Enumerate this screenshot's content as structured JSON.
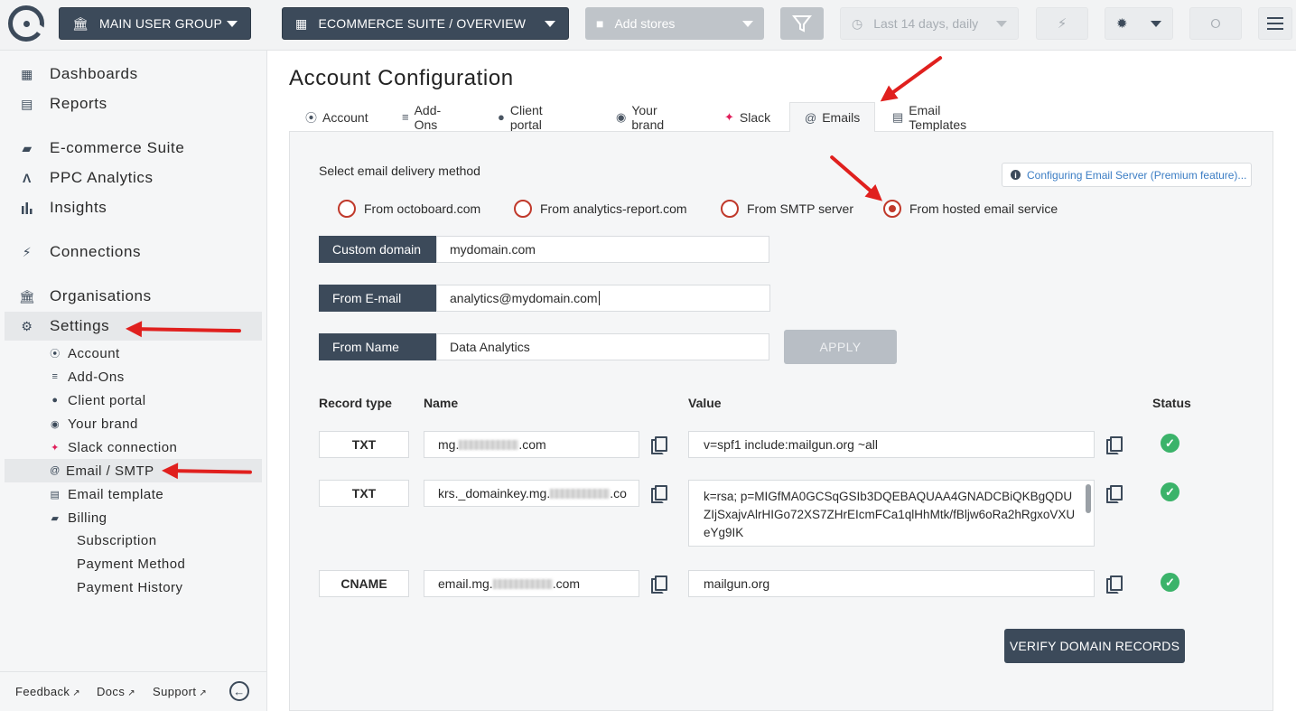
{
  "topbar": {
    "user_group": "MAIN USER GROUP",
    "dashboard": "ECOMMERCE SUITE / OVERVIEW",
    "stores_placeholder": "Add stores",
    "date_range": "Last 14 days, daily"
  },
  "sidebar": {
    "main_items": [
      {
        "label": "Dashboards",
        "icon": "dashboard-icon"
      },
      {
        "label": "Reports",
        "icon": "clipboard-icon"
      },
      {
        "label": "E-commerce Suite",
        "icon": "bag-icon"
      },
      {
        "label": "PPC Analytics",
        "icon": "ppc-icon"
      },
      {
        "label": "Insights",
        "icon": "bar-chart-icon"
      },
      {
        "label": "Connections",
        "icon": "plug-icon"
      },
      {
        "label": "Organisations",
        "icon": "bank-icon"
      },
      {
        "label": "Settings",
        "icon": "gear-icon"
      }
    ],
    "settings_items": [
      {
        "label": "Account"
      },
      {
        "label": "Add-Ons"
      },
      {
        "label": "Client portal"
      },
      {
        "label": "Your brand"
      },
      {
        "label": "Slack connection"
      },
      {
        "label": "Email / SMTP"
      },
      {
        "label": "Email template"
      },
      {
        "label": "Billing"
      }
    ],
    "billing_items": [
      {
        "label": "Subscription"
      },
      {
        "label": "Payment Method"
      },
      {
        "label": "Payment History"
      }
    ],
    "footer": {
      "feedback": "Feedback",
      "docs": "Docs",
      "support": "Support"
    }
  },
  "main": {
    "title": "Account Configuration",
    "tabs": [
      {
        "label": "Account"
      },
      {
        "label": "Add-Ons"
      },
      {
        "label": "Client portal"
      },
      {
        "label": "Your brand"
      },
      {
        "label": "Slack"
      },
      {
        "label": "Emails"
      },
      {
        "label": "Email Templates"
      }
    ],
    "delivery_label": "Select email delivery method",
    "info_link": "Configuring Email Server (Premium feature)...",
    "radio_options": [
      {
        "label": "From octoboard.com",
        "checked": false
      },
      {
        "label": "From analytics-report.com",
        "checked": false
      },
      {
        "label": "From SMTP server",
        "checked": false
      },
      {
        "label": "From hosted email service",
        "checked": true
      }
    ],
    "fields": {
      "custom_domain": {
        "label": "Custom domain",
        "value": "mydomain.com"
      },
      "from_email": {
        "label": "From E-mail",
        "value": "analytics@mydomain.com"
      },
      "from_name": {
        "label": "From Name",
        "value": "Data Analytics"
      }
    },
    "apply_label": "APPLY",
    "table": {
      "headers": {
        "type": "Record type",
        "name": "Name",
        "value": "Value",
        "status": "Status"
      },
      "rows": [
        {
          "type": "TXT",
          "name_prefix": "mg.",
          "name_suffix": ".com",
          "value": "v=spf1 include:mailgun.org ~all"
        },
        {
          "type": "TXT",
          "name_prefix": "krs._domainkey.mg.",
          "name_suffix": ".co",
          "value": "k=rsa; p=MIGfMA0GCSqGSIb3DQEBAQUAA4GNADCBiQKBgQDUZIjSxajvAlrHIGo72XS7ZHrEIcmFCa1qlHhMtk/fBljw6oRa2hRgxoVXUeYg9IK"
        },
        {
          "type": "CNAME",
          "name_prefix": "email.mg.",
          "name_suffix": ".com",
          "value": "mailgun.org"
        }
      ]
    },
    "verify_label": "VERIFY DOMAIN RECORDS"
  }
}
